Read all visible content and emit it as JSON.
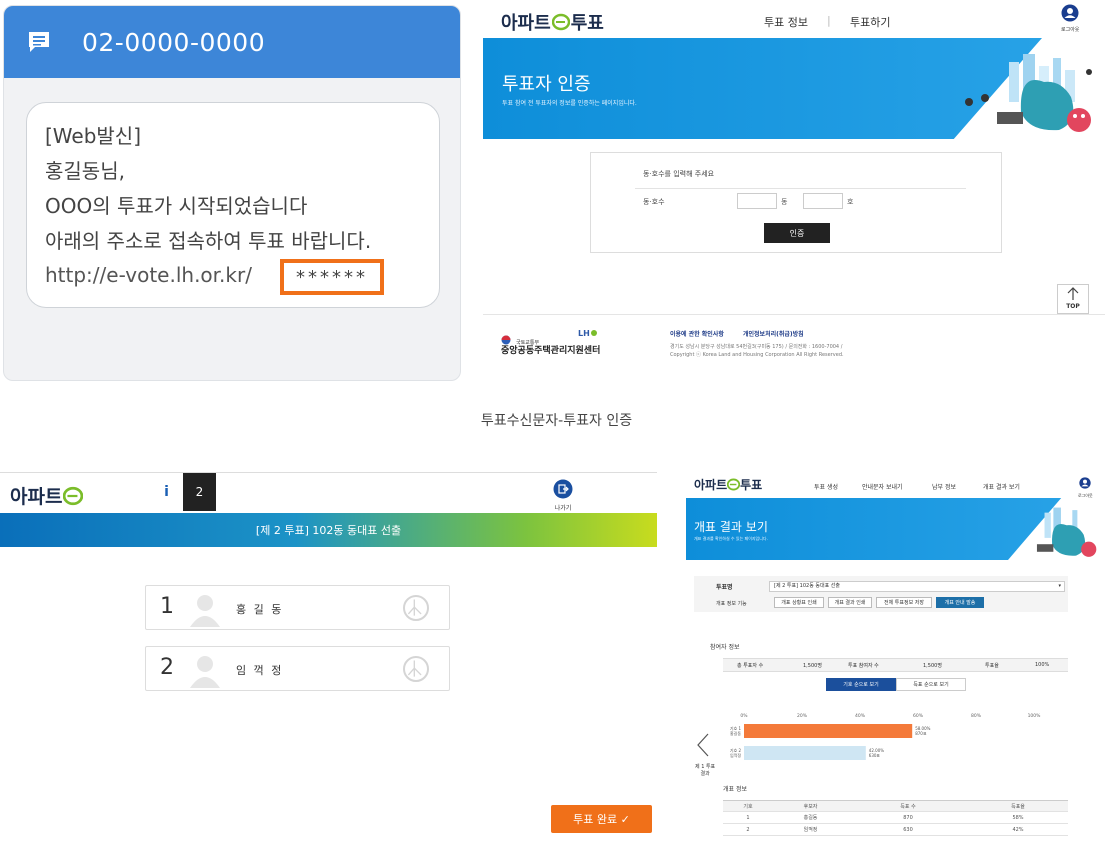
{
  "sms": {
    "phone_number": "02-0000-0000",
    "icon": "message-icon",
    "lines": [
      "[Web발신]",
      "홍길동님,",
      "OOO의 투표가 시작되었습니다",
      "아래의 주소로 접속하여 투표 바랍니다."
    ],
    "url": "http://e-vote.lh.or.kr/",
    "password": "******",
    "highlight_color": "#f07019",
    "header_color": "#3d86d8"
  },
  "auth": {
    "logo_left": "아파트",
    "logo_right": "투표",
    "nav": [
      "투표 정보",
      "투표하기"
    ],
    "logout": "로그아웃",
    "banner_title": "투표자 인증",
    "banner_sub": "투표 참여 전 투표자의 정보를 인증하는 페이지입니다.",
    "prompt": "동·호수를 입력해 주세요",
    "field_label": "동·호수",
    "dong": "동",
    "ho": "호",
    "submit": "인증",
    "top": "TOP",
    "footer": {
      "ministry": "국토교통부",
      "lh": "LH",
      "center": "중앙공동주택관리지원센터",
      "links": [
        "이용에 관한 확인사항",
        "개인정보처리(취급)방침"
      ],
      "address": "경기도 성남시 분당구 성남대로 54번길3(구미동 175) / 문의전화 : 1600-7004 /",
      "copyright": "Copyright ⓒ Korea Land and Housing Corporation All Right Reserved."
    }
  },
  "caption": "투표수신문자-투표자 인증",
  "vote": {
    "logo_left": "아파트",
    "step_info": "i",
    "step_num": "2",
    "exit": "나가기",
    "title": "[제 2 투표] 102동 동대표 선출",
    "candidates": [
      {
        "num": "1",
        "name": "홍 길 동"
      },
      {
        "num": "2",
        "name": "임 꺽 정"
      }
    ],
    "done": "투표 완료 ✓",
    "accent": "#f07019"
  },
  "results": {
    "logo_left": "아파트",
    "logo_right": "투표",
    "nav": [
      "투표 생성",
      "안내문자 보내기",
      "납부 정보",
      "개표 결과 보기"
    ],
    "logout": "로그아웃",
    "banner_title": "개표 결과 보기",
    "banner_sub": "개표 결과를 확인하실 수 있는 페이지입니다.",
    "vote_name_label": "투표명",
    "vote_name_value": "[제 2 투표] 102동 동대표 선출",
    "func_label": "개표 정보 기능",
    "func_buttons": [
      "개표 상황표 인쇄",
      "개표 결과 인쇄",
      "전체 투표정보 저장",
      "개표 안내 발송"
    ],
    "participant_title": "참여자 정보",
    "participant": {
      "total_label": "총 투표자 수",
      "total": "1,500명",
      "voted_label": "투표 참여자 수",
      "voted": "1,500명",
      "rate_label": "투표율",
      "rate": "100%"
    },
    "toggles": [
      "기호 순으로 보기",
      "득표 순으로 보기"
    ],
    "prev_label": "제 1 투표\n결과",
    "count_title": "개표 정보",
    "table_headers": [
      "기호",
      "후보자",
      "득표 수",
      "득표율"
    ],
    "table_rows": [
      [
        "1",
        "홍길동",
        "870",
        "58%"
      ],
      [
        "2",
        "임꺽정",
        "630",
        "42%"
      ]
    ]
  },
  "chart_data": {
    "type": "bar",
    "orientation": "horizontal",
    "ticks": [
      "0%",
      "20%",
      "40%",
      "60%",
      "80%",
      "100%"
    ],
    "xlim": [
      0,
      100
    ],
    "categories": [
      "기호 1\n홍길동",
      "기호 2\n임꺽정"
    ],
    "values": [
      58,
      42
    ],
    "value_labels": [
      "58.00%\n870표",
      "42.00%\n630표"
    ],
    "colors": [
      "#f47a3a",
      "#cfe6f3"
    ]
  }
}
